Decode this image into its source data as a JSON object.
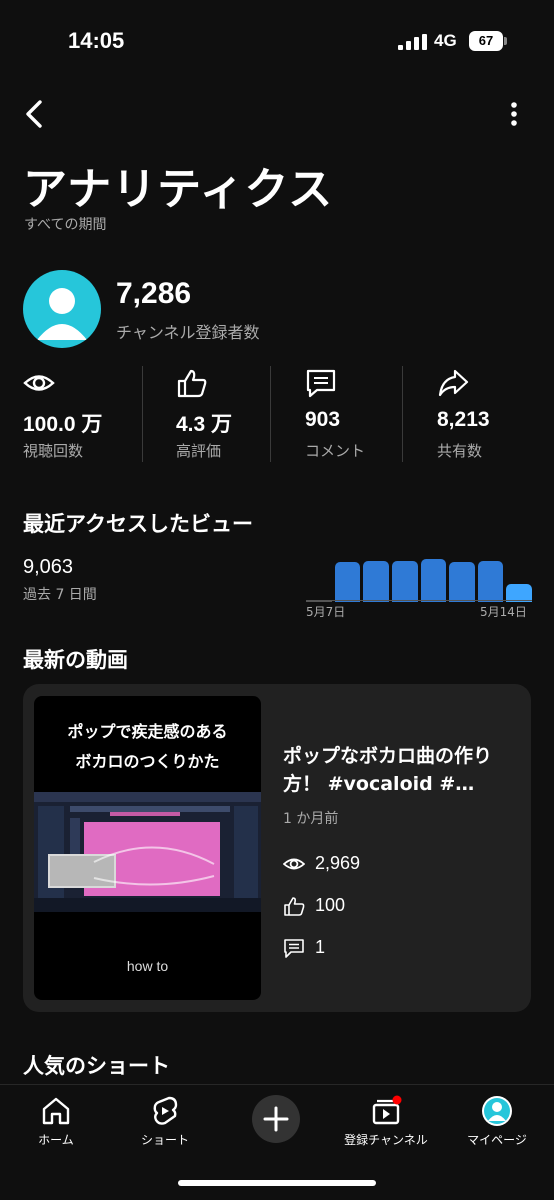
{
  "status_bar": {
    "time": "14:05",
    "network": "4G",
    "battery": "67"
  },
  "header": {
    "title": "アナリティクス",
    "subtitle": "すべての期間"
  },
  "channel": {
    "subscribers": "7,286",
    "subscribers_label": "チャンネル登録者数"
  },
  "stats": [
    {
      "icon": "eye-icon",
      "value": "100.0 万",
      "label": "視聴回数"
    },
    {
      "icon": "thumbs-up-icon",
      "value": "4.3 万",
      "label": "高評価"
    },
    {
      "icon": "comment-icon",
      "value": "903",
      "label": "コメント"
    },
    {
      "icon": "share-icon",
      "value": "8,213",
      "label": "共有数"
    }
  ],
  "recent_views": {
    "title": "最近アクセスしたビュー",
    "value": "9,063",
    "label": "過去 7 日間",
    "axis_start": "5月7日",
    "axis_end": "5月14日",
    "bars": [
      0,
      0.74,
      0.76,
      0.76,
      0.8,
      0.74,
      0.76,
      0.34
    ]
  },
  "latest_video": {
    "section_title": "最新の動画",
    "thumbnail_line1": "ポップで疾走感のある",
    "thumbnail_line2": "ボカロのつくりかた",
    "thumbnail_caption": "how to",
    "title": "ポップなボカロ曲の作り方！ #vocaloid #…",
    "age": "1 か月前",
    "views": "2,969",
    "likes": "100",
    "comments": "1"
  },
  "popular": {
    "title": "人気のショート"
  },
  "bottom_nav": {
    "home": "ホーム",
    "shorts": "ショート",
    "subscriptions": "登録チャンネル",
    "you": "マイページ"
  },
  "colors": {
    "background": "#0f0f0f",
    "bar": "#2f7ad6",
    "bar_highlight": "#3ea6ff",
    "avatar": "#26c6da",
    "card": "#212121"
  }
}
